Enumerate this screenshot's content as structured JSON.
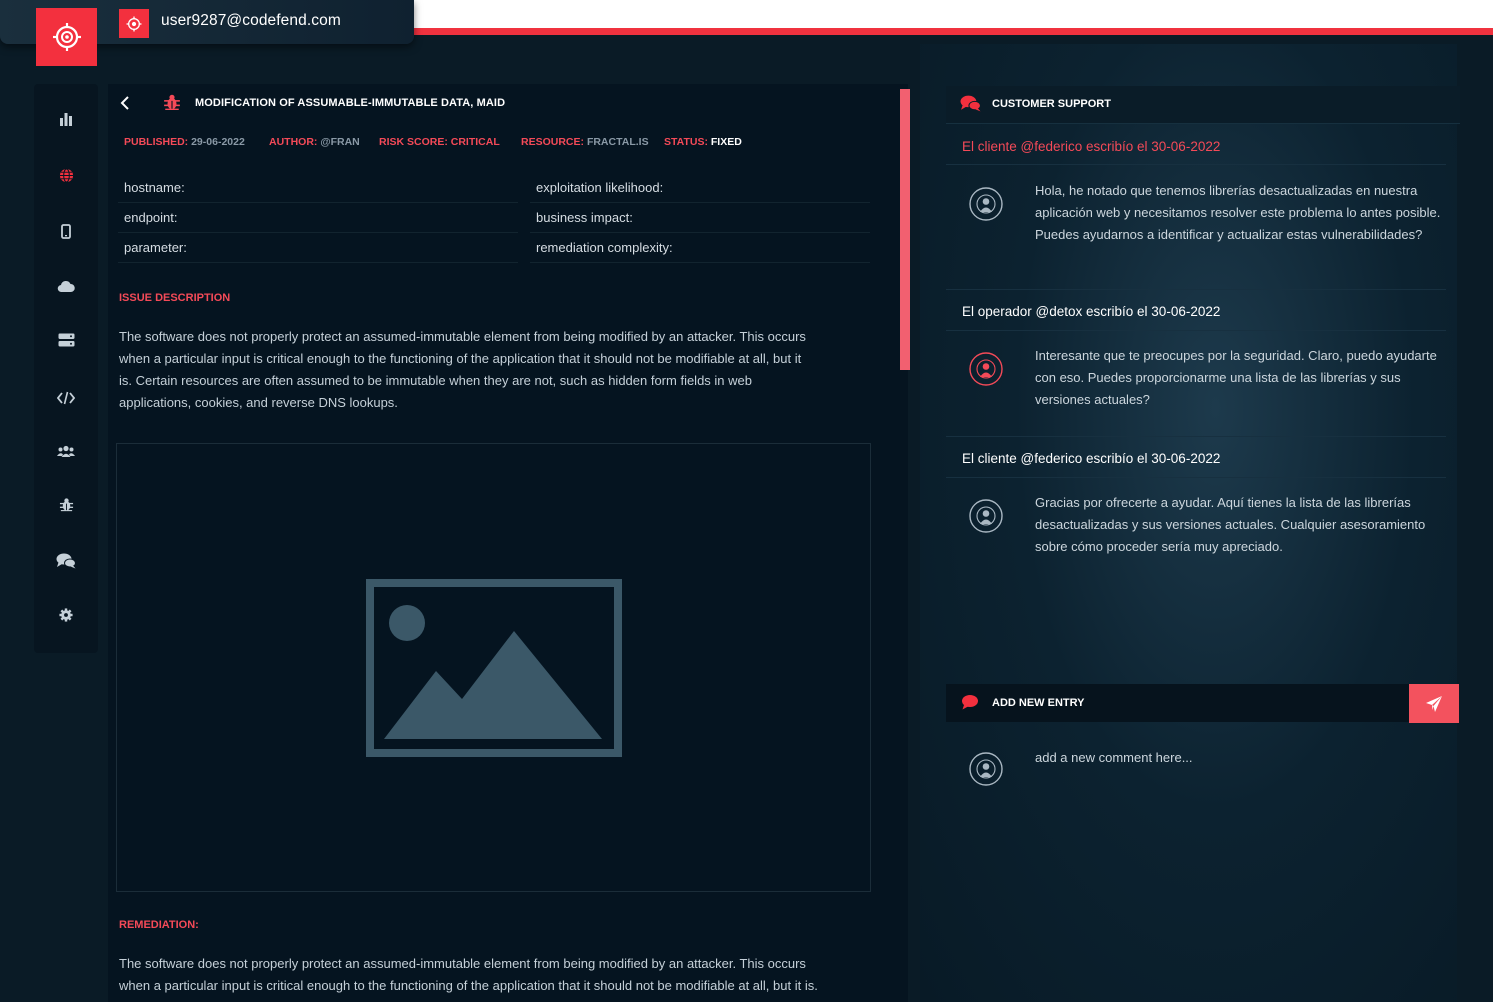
{
  "colors": {
    "accent": "#f3303e",
    "accent_text": "#f44a58",
    "background": "#0a1b26"
  },
  "header": {
    "user_email": "user9287@codefend.com"
  },
  "sidebar": {
    "items": [
      {
        "icon": "bar-chart-icon"
      },
      {
        "icon": "globe-icon",
        "active": true
      },
      {
        "icon": "mobile-icon"
      },
      {
        "icon": "cloud-icon"
      },
      {
        "icon": "server-icon"
      },
      {
        "icon": "code-icon"
      },
      {
        "icon": "users-icon"
      },
      {
        "icon": "bug-icon"
      },
      {
        "icon": "chat-icon"
      },
      {
        "icon": "gear-icon"
      }
    ]
  },
  "issue": {
    "title": "MODIFICATION OF ASSUMABLE-IMMUTABLE DATA, MAID",
    "meta": {
      "published_label": "PUBLISHED:",
      "published_value": "29-06-2022",
      "author_label": "AUTHOR:",
      "author_value": "@FRAN",
      "risk_label": "RISK SCORE: CRITICAL",
      "resource_label": "RESOURCE:",
      "resource_value": "FRACTAL.IS",
      "status_label": "STATUS:",
      "status_value": "FIXED"
    },
    "fields": {
      "hostname": "hostname:",
      "endpoint": "endpoint:",
      "parameter": "parameter:",
      "exploitation": "exploitation likelihood:",
      "business": "business impact:",
      "remediation_complexity": "remediation complexity:"
    },
    "description_heading": "ISSUE DESCRIPTION",
    "description_lines": [
      "The software does not properly protect an assumed-immutable element from being modified by an attacker. This occurs",
      "when a particular input is critical enough to the functioning of the application that it should not be modifiable at all, but it",
      "is. Certain resources are often assumed to be immutable when they are not, such as hidden form fields in web",
      "applications, cookies, and reverse DNS lookups."
    ],
    "remediation_heading": "REMEDIATION:",
    "remediation_lines": [
      "The software does not properly protect an assumed-immutable element from being modified by an attacker. This occurs",
      "when a particular input is critical enough to the functioning of the application that it should not be modifiable at all, but it is."
    ]
  },
  "support": {
    "title": "CUSTOMER SUPPORT",
    "messages": [
      {
        "author": "El cliente @federico escribío el 30-06-2022",
        "text": "Hola, he notado que tenemos librerías desactualizadas en nuestra aplicación web y necesitamos resolver este problema lo antes posible. Puedes ayudarnos a identificar y actualizar estas vulnerabilidades?"
      },
      {
        "author": "El operador @detox escribío el 30-06-2022",
        "text": "Interesante que te preocupes por la seguridad. Claro, puedo ayudarte con eso. Puedes proporcionarme una lista de las librerías y sus versiones actuales?"
      },
      {
        "author": "El cliente @federico escribío el 30-06-2022",
        "text": "Gracias por ofrecerte a ayudar. Aquí tienes la lista de las librerías desactualizadas y sus versiones actuales. Cualquier asesoramiento sobre cómo proceder sería muy apreciado."
      }
    ],
    "add_entry_label": "ADD NEW ENTRY",
    "comment_placeholder": "add a new comment here..."
  }
}
